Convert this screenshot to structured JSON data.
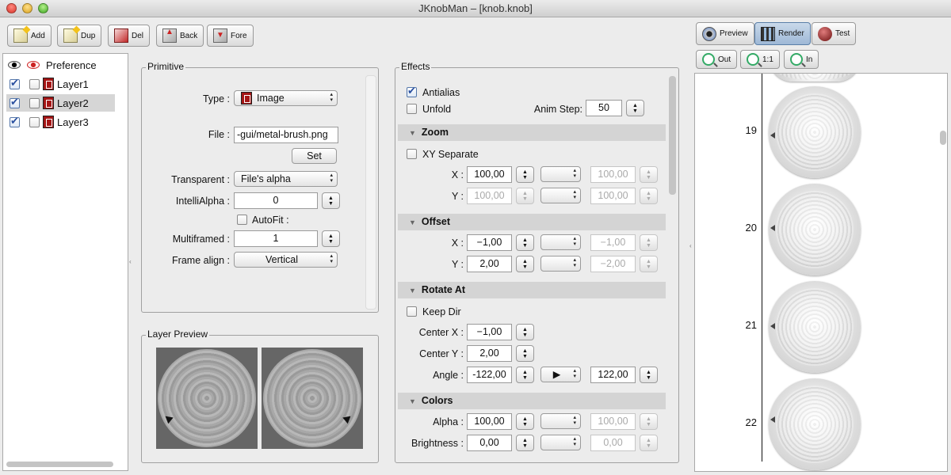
{
  "window": {
    "title": "JKnobMan – [knob.knob]"
  },
  "toolbar": {
    "add": "Add",
    "dup": "Dup",
    "del": "Del",
    "back": "Back",
    "fore": "Fore"
  },
  "right_toolbar": {
    "preview": "Preview",
    "render": "Render",
    "test": "Test",
    "zoom_out": "Out",
    "zoom_1to1": "1:1",
    "zoom_in": "In"
  },
  "layers": {
    "preference": "Preference",
    "items": [
      {
        "label": "Layer1",
        "visible": true,
        "solo": false
      },
      {
        "label": "Layer2",
        "visible": true,
        "solo": false,
        "selected": true
      },
      {
        "label": "Layer3",
        "visible": true,
        "solo": false
      }
    ]
  },
  "primitive": {
    "title": "Primitive",
    "type_label": "Type :",
    "type_value": "Image",
    "file_label": "File :",
    "file_value": "-gui/metal-brush.png",
    "set_button": "Set",
    "transparent_label": "Transparent :",
    "transparent_value": "File's alpha",
    "intellialpha_label": "IntelliAlpha :",
    "intellialpha_value": "0",
    "autofit_label": "AutoFit :",
    "multiframed_label": "Multiframed :",
    "multiframed_value": "1",
    "frame_align_label": "Frame align :",
    "frame_align_value": "Vertical"
  },
  "layer_preview": {
    "title": "Layer Preview"
  },
  "effects": {
    "title": "Effects",
    "antialias": "Antialias",
    "unfold": "Unfold",
    "anim_step_label": "Anim Step:",
    "anim_step_value": "50",
    "zoom": {
      "header": "Zoom",
      "xy_separate": "XY Separate",
      "x_label": "X :",
      "x_value": "100,00",
      "x_to": "100,00",
      "y_label": "Y :",
      "y_value": "100,00",
      "y_to": "100,00"
    },
    "offset": {
      "header": "Offset",
      "x_label": "X :",
      "x_value": "−1,00",
      "x_to": "−1,00",
      "y_label": "Y :",
      "y_value": "2,00",
      "y_to": "−2,00"
    },
    "rotate": {
      "header": "Rotate At",
      "keep_dir": "Keep Dir",
      "cx_label": "Center X :",
      "cx_value": "−1,00",
      "cy_label": "Center Y :",
      "cy_value": "2,00",
      "angle_label": "Angle :",
      "angle_value": "-122,00",
      "angle_curve": "▶",
      "angle_to": "122,00"
    },
    "colors": {
      "header": "Colors",
      "alpha_label": "Alpha :",
      "alpha_value": "100,00",
      "alpha_to": "100,00",
      "brightness_label": "Brightness :",
      "brightness_value": "0,00",
      "brightness_to": "0,00"
    }
  },
  "render": {
    "frames": [
      "19",
      "20",
      "21",
      "22"
    ]
  }
}
